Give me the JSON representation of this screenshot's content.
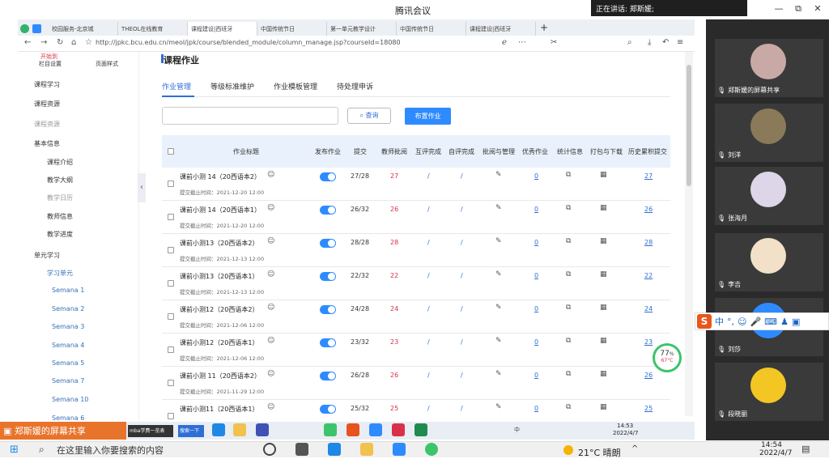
{
  "app": {
    "title": "腾讯会议",
    "speaking": "正在讲话: 郑斯媛;",
    "win_min": "—",
    "win_max": "⧉",
    "win_close": "✕"
  },
  "browser": {
    "tabs": [
      "校园服务-北京城",
      "THEOL在线教育",
      "课程建设|西班牙",
      "中国传统节日",
      "第一单元教学设计",
      "中国传统节日",
      "课程建设|西班牙"
    ],
    "url": "http://jpkc.bcu.edu.cn/meol/jpk/course/blended_module/column_manage.jsp?courseId=18080",
    "new_tab": "+"
  },
  "sidebar": {
    "top_links": [
      "栏目设置",
      "页面样式"
    ],
    "top_name": "开始到",
    "items": [
      {
        "label": "课程学习",
        "style": "normal"
      },
      {
        "label": "课程资源",
        "style": "normal"
      },
      {
        "label": "课程资源",
        "style": "dim"
      },
      {
        "label": "基本信息",
        "style": "normal"
      },
      {
        "label": "课程介绍",
        "style": "normal"
      },
      {
        "label": "教学大纲",
        "style": "normal"
      },
      {
        "label": "教学日历",
        "style": "dim"
      },
      {
        "label": "教师信息",
        "style": "normal"
      },
      {
        "label": "教学进度",
        "style": "normal"
      },
      {
        "label": "单元学习",
        "style": "normal"
      },
      {
        "label": "学习单元",
        "style": "sub"
      },
      {
        "label": "Semana 1",
        "style": "sub"
      },
      {
        "label": "Semana 2",
        "style": "sub"
      },
      {
        "label": "Semana 3",
        "style": "sub"
      },
      {
        "label": "Semana 4",
        "style": "sub"
      },
      {
        "label": "Semana 5",
        "style": "sub"
      },
      {
        "label": "Semana 7",
        "style": "sub"
      },
      {
        "label": "Semana 10",
        "style": "sub"
      },
      {
        "label": "Semana 6",
        "style": "sub"
      }
    ]
  },
  "main": {
    "title": "课程作业",
    "tabs": [
      "作业管理",
      "等级标准维护",
      "作业模板管理",
      "待处理申诉"
    ],
    "query_label": "查询",
    "add_label": "布置作业",
    "columns": [
      "作业标题",
      "发布作业",
      "提交",
      "教师批阅",
      "互评完成",
      "自评完成",
      "批阅与管理",
      "优秀作业",
      "统计信息",
      "打包与下载",
      "历史累积提交"
    ],
    "rows": [
      {
        "title": "课前小测 14（20西语本2）",
        "deadline": "提交截止时间：2021-12-20 12:00",
        "submit": "27/28",
        "graded": "27",
        "peer": "/",
        "self": "/",
        "excellent": "0",
        "history": "27"
      },
      {
        "title": "课前小测 14（20西语本1）",
        "deadline": "提交截止时间：2021-12-20 12:00",
        "submit": "26/32",
        "graded": "26",
        "peer": "/",
        "self": "/",
        "excellent": "0",
        "history": "26"
      },
      {
        "title": "课前小测13（20西语本2）",
        "deadline": "提交截止时间：2021-12-13 12:00",
        "submit": "28/28",
        "graded": "28",
        "peer": "/",
        "self": "/",
        "excellent": "0",
        "history": "28"
      },
      {
        "title": "课前小测13（20西语本1）",
        "deadline": "提交截止时间：2021-12-13 12:00",
        "submit": "22/32",
        "graded": "22",
        "peer": "/",
        "self": "/",
        "excellent": "0",
        "history": "22"
      },
      {
        "title": "课前小测12（20西语本2）",
        "deadline": "提交截止时间：2021-12-06 12:00",
        "submit": "24/28",
        "graded": "24",
        "peer": "/",
        "self": "/",
        "excellent": "0",
        "history": "24"
      },
      {
        "title": "课前小测12（20西语本1）",
        "deadline": "提交截止时间：2021-12-06 12:00",
        "submit": "23/32",
        "graded": "23",
        "peer": "/",
        "self": "/",
        "excellent": "0",
        "history": "23"
      },
      {
        "title": "课前小测 11（20西语本2）",
        "deadline": "提交截止时间：2021-11-29 12:00",
        "submit": "26/28",
        "graded": "26",
        "peer": "/",
        "self": "/",
        "excellent": "0",
        "history": "26"
      },
      {
        "title": "课前小测11（20西语本1）",
        "deadline": "",
        "submit": "25/32",
        "graded": "25",
        "peer": "/",
        "self": "/",
        "excellent": "0",
        "history": "25"
      }
    ]
  },
  "gauge": {
    "percent": "77",
    "unit": "%",
    "temp": "67°C"
  },
  "participants": [
    {
      "name": "郑斯媛的屏幕共享",
      "avatar_color": "#c9a9a6"
    },
    {
      "name": "刘洋",
      "avatar_color": "#8a7a5a"
    },
    {
      "name": "张海月",
      "avatar_color": "#dcd6e8"
    },
    {
      "name": "李吉",
      "avatar_color": "#f2e1c8"
    },
    {
      "name": "刘莎",
      "avatar_color": "#2e8bff"
    },
    {
      "name": "段晓丽",
      "avatar_color": "#f3c623"
    }
  ],
  "ime": {
    "logo": "S",
    "mode": "中"
  },
  "share_badge": "郑斯媛的屏幕共享",
  "inner_taskbar": {
    "item1": "mba学费一览表",
    "item2": "搜索一下",
    "time": "14:53",
    "date": "2022/4/7",
    "lang": "中"
  },
  "taskbar": {
    "search_placeholder": "在这里输入你要搜索的内容",
    "weather": "21°C 晴朗",
    "time": "14:54",
    "date": "2022/4/7"
  }
}
